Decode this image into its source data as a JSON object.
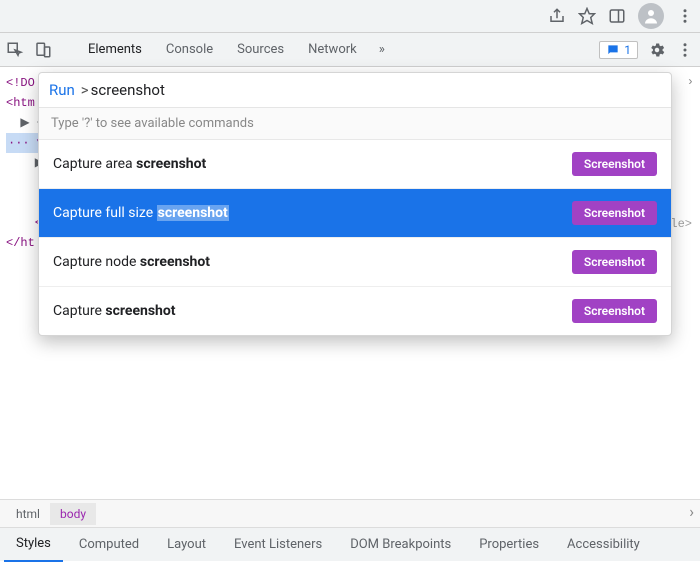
{
  "browser": {
    "icons": [
      "share-icon",
      "star-icon",
      "panel-icon",
      "profile-icon",
      "kebab-icon"
    ]
  },
  "devtools": {
    "tabs": [
      "Elements",
      "Console",
      "Sources",
      "Network"
    ],
    "active_tab": "Elements",
    "overflow": "»",
    "issues_count": "1",
    "dom": {
      "l0": "<!DO",
      "l1": "<htm",
      "l2_pre": "  ▶ <h",
      "l3_pre": "··· ▼ <b",
      "l4_pre": "    ▶ ",
      "l5_pre": "      ▶",
      "l6_pre": "      ▶",
      "l7_pre": "    </",
      "l8": "</ht",
      "peek": "le>"
    }
  },
  "command_menu": {
    "run_label": "Run",
    "caret": ">",
    "query": "screenshot",
    "hint": "Type '?' to see available commands",
    "badge_label": "Screenshot",
    "items": [
      {
        "prefix": "Capture area ",
        "match": "screenshot",
        "selected": false
      },
      {
        "prefix": "Capture full size ",
        "match": "screenshot",
        "selected": true
      },
      {
        "prefix": "Capture node ",
        "match": "screenshot",
        "selected": false
      },
      {
        "prefix": "Capture ",
        "match": "screenshot",
        "selected": false
      }
    ]
  },
  "breadcrumb": {
    "items": [
      "html",
      "body"
    ],
    "selected": "body"
  },
  "subtabs": {
    "items": [
      "Styles",
      "Computed",
      "Layout",
      "Event Listeners",
      "DOM Breakpoints",
      "Properties",
      "Accessibility"
    ],
    "active": "Styles"
  }
}
